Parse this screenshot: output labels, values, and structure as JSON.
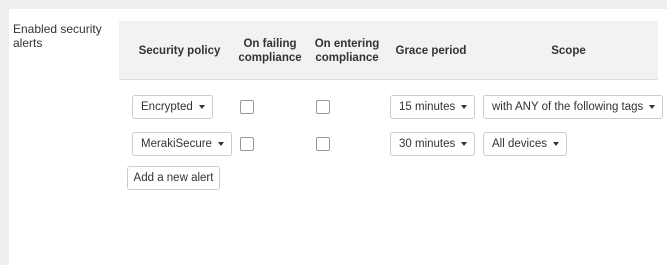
{
  "section": {
    "label": "Enabled security alerts"
  },
  "table": {
    "headers": {
      "security_policy": "Security policy",
      "on_failing": "On failing compliance",
      "on_entering": "On entering compliance",
      "grace_period": "Grace period",
      "scope": "Scope"
    },
    "rows": [
      {
        "policy": "Encrypted",
        "on_failing": false,
        "on_entering": false,
        "grace_period": "15 minutes",
        "scope": "with ANY of the following tags"
      },
      {
        "policy": "MerakiSecure",
        "on_failing": false,
        "on_entering": false,
        "grace_period": "30 minutes",
        "scope": "All devices"
      }
    ]
  },
  "actions": {
    "add_alert": "Add a new alert"
  },
  "icons": {
    "dropdown": "caret-down-icon"
  }
}
